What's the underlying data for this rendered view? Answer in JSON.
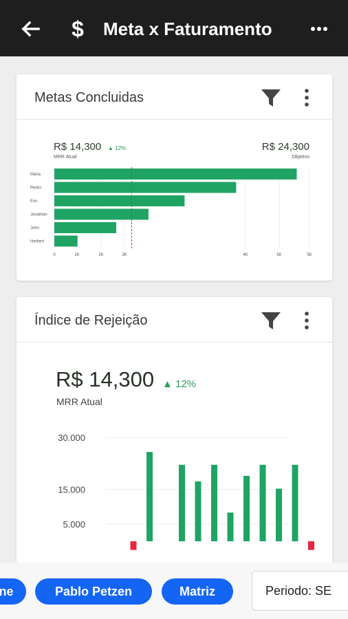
{
  "header": {
    "title": "Meta x Faturamento",
    "back_icon": "arrow-left-icon",
    "app_icon": "dollar-icon",
    "more_icon": "more-horizontal-icon"
  },
  "cards": {
    "goals": {
      "title": "Metas Concluidas",
      "current_value": "R$ 14,300",
      "delta": "12%",
      "current_label": "MRR Atual",
      "target_value": "R$ 24,300",
      "target_label": "Objetivo"
    },
    "rejection": {
      "title": "Índice de Rejeição",
      "current_value": "R$ 14,300",
      "delta": "12%",
      "current_label": "MRR Atual"
    }
  },
  "bottom_bar": {
    "chips": [
      "ne",
      "Pablo Petzen",
      "Matriz"
    ],
    "period_text": "Periodo: SE"
  },
  "colors": {
    "accent": "#1565f5",
    "positive": "#1fa463",
    "negative": "#e8263f",
    "header_bg": "#1e1e1e"
  },
  "chart_data": [
    {
      "type": "bar",
      "orientation": "horizontal",
      "categories": [
        "Maria",
        "Pedro",
        "Evo",
        "Jonathan",
        "John",
        "Herbert"
      ],
      "values": [
        9400,
        7050,
        5050,
        3650,
        2400,
        900
      ],
      "x_ticks": [
        "0",
        "1K",
        "2K",
        "3K",
        "4K",
        "5K",
        "5K"
      ],
      "reference_line": 3000,
      "grid": true
    },
    {
      "type": "bar",
      "y_ticks": [
        "30.000",
        "15.000",
        "5.000"
      ],
      "ylim": [
        0,
        30000
      ],
      "values": [
        -2500,
        25800,
        0,
        22100,
        17300,
        22100,
        8300,
        18900,
        22100,
        15200,
        22100,
        -2500
      ],
      "grid": true
    }
  ]
}
